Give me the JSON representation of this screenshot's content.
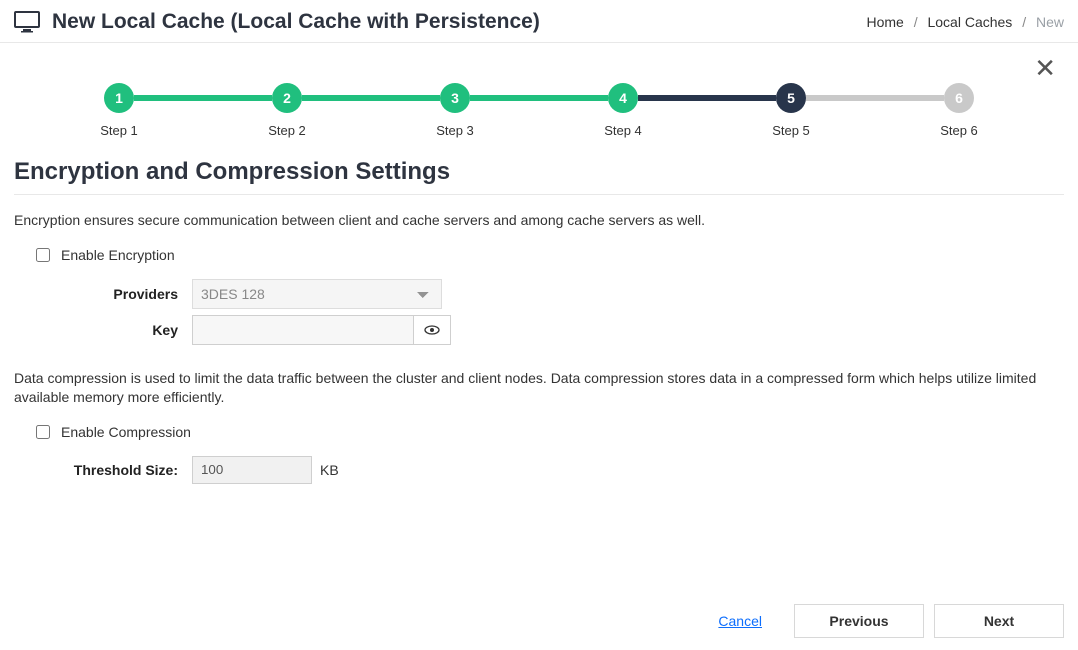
{
  "header": {
    "title": "New Local Cache (Local Cache with Persistence)"
  },
  "breadcrumb": {
    "items": [
      "Home",
      "Local Caches",
      "New"
    ]
  },
  "stepper": {
    "steps": [
      {
        "num": "1",
        "label": "Step 1",
        "state": "complete"
      },
      {
        "num": "2",
        "label": "Step 2",
        "state": "complete"
      },
      {
        "num": "3",
        "label": "Step 3",
        "state": "complete"
      },
      {
        "num": "4",
        "label": "Step 4",
        "state": "complete"
      },
      {
        "num": "5",
        "label": "Step 5",
        "state": "active"
      },
      {
        "num": "6",
        "label": "Step 6",
        "state": "upcoming"
      }
    ]
  },
  "section": {
    "title": "Encryption and Compression Settings",
    "encryption_hint": "Encryption ensures secure communication between client and cache servers and among cache servers as well.",
    "enable_encryption_label": "Enable Encryption",
    "enable_encryption_checked": false,
    "providers_label": "Providers",
    "providers_selected": "3DES 128",
    "key_label": "Key",
    "key_value": "",
    "compression_hint": "Data compression is used to limit the data traffic between the cluster and client nodes. Data compression stores data in a compressed form which helps utilize limited available memory more efficiently.",
    "enable_compression_label": "Enable Compression",
    "enable_compression_checked": false,
    "threshold_label": "Threshold Size:",
    "threshold_value": "100",
    "threshold_unit": "KB"
  },
  "footer": {
    "cancel": "Cancel",
    "previous": "Previous",
    "next": "Next"
  }
}
